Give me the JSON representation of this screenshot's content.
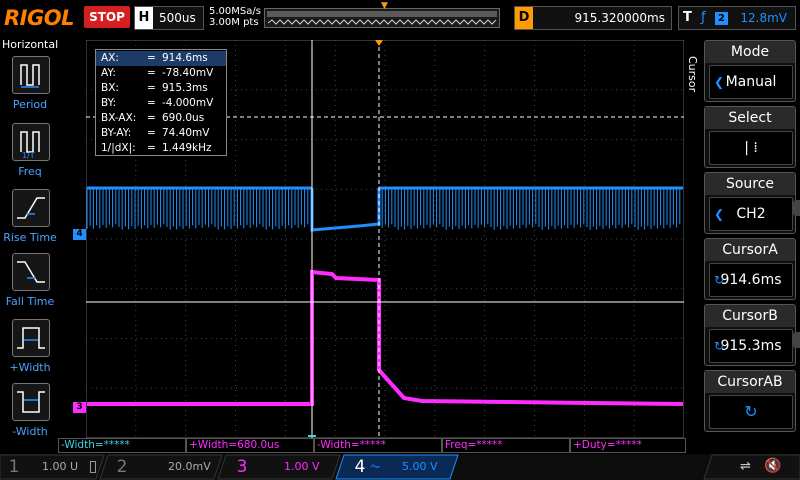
{
  "topbar": {
    "brand": "RIGOL",
    "run_state": "STOP",
    "horizontal_letter": "H",
    "timebase": "500us",
    "sample_rate": "5.00MSa/s",
    "memory_depth": "3.00M pts",
    "delay_letter": "D",
    "delay_value": "915.320000ms",
    "trigger_letter": "T",
    "trigger_source": "2",
    "trigger_level": "12.8mV"
  },
  "left_panel": {
    "title": "Horizontal",
    "items": [
      {
        "label": "Period",
        "icon": "period-icon"
      },
      {
        "label": "Freq",
        "icon": "freq-icon"
      },
      {
        "label": "Rise Time",
        "icon": "rise-time-icon"
      },
      {
        "label": "Fall Time",
        "icon": "fall-time-icon"
      },
      {
        "label": "+Width",
        "icon": "positive-width-icon"
      },
      {
        "label": "-Width",
        "icon": "negative-width-icon"
      }
    ]
  },
  "cursor_readout": [
    {
      "key": "AX:",
      "value": "914.6ms"
    },
    {
      "key": "AY:",
      "value": "-78.40mV"
    },
    {
      "key": "BX:",
      "value": "915.3ms"
    },
    {
      "key": "BY:",
      "value": "-4.000mV"
    },
    {
      "key": "BX-AX:",
      "value": "690.0us"
    },
    {
      "key": "BY-AY:",
      "value": "74.40mV"
    },
    {
      "key": "1/|dX|:",
      "value": "1.449kHz"
    }
  ],
  "trace_markers": {
    "ch4": "4",
    "ch3": "3"
  },
  "right_panel": {
    "vertical_label": "Cursor",
    "items": [
      {
        "title": "Mode",
        "value": "Manual"
      },
      {
        "title": "Select",
        "value": "| ⁞"
      },
      {
        "title": "Source",
        "value": "CH2"
      },
      {
        "title": "CursorA",
        "value": "914.6ms"
      },
      {
        "title": "CursorB",
        "value": "915.3ms"
      },
      {
        "title": "CursorAB",
        "value": ""
      }
    ]
  },
  "measurements": [
    {
      "label": "-Width=*****",
      "color": "#36d6e3"
    },
    {
      "label": "+Width=680.0us",
      "color": "#ff2cff"
    },
    {
      "label": "-Width=*****",
      "color": "#ff2cff"
    },
    {
      "label": "Freq=*****",
      "color": "#ff2cff"
    },
    {
      "label": "+Duty=*****",
      "color": "#ff2cff"
    }
  ],
  "channels": [
    {
      "num": "1",
      "coupling": "",
      "scale": "1.00 U",
      "color": "#c8c800"
    },
    {
      "num": "2",
      "coupling": "",
      "scale": "20.0mV",
      "color": "#36d6e3"
    },
    {
      "num": "3",
      "coupling": "",
      "scale": "1.00 V",
      "color": "#ff2cff"
    },
    {
      "num": "4",
      "coupling": "",
      "scale": "5.00 V",
      "color": "#1e90ff"
    }
  ],
  "colors": {
    "ch1": "#c8c800",
    "ch2": "#36d6e3",
    "ch3": "#ff2cff",
    "ch4": "#1e90ff",
    "stop": "#d42020",
    "cursor_selected": "#1c3b66",
    "accent": "#ff9a00"
  },
  "waveforms": {
    "ch4_high": 5.0,
    "ch4_low": 0.0,
    "ch3_high": 2.6,
    "ch3_low": 0.0
  }
}
